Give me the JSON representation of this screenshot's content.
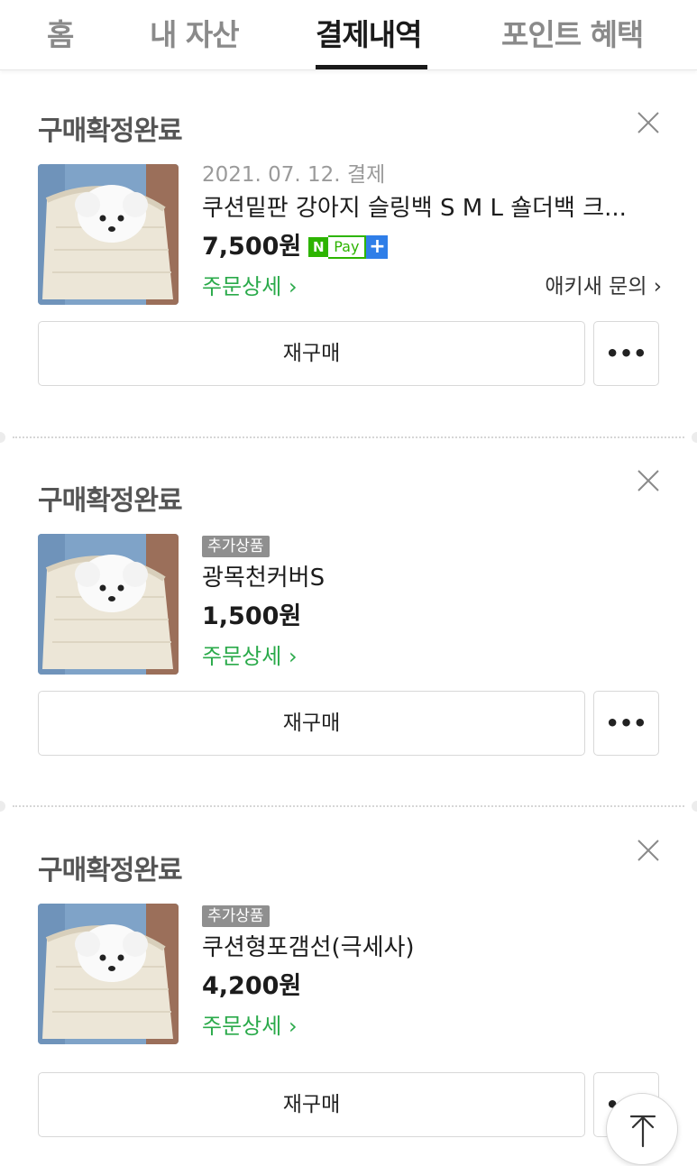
{
  "tabs": [
    {
      "label": "홈"
    },
    {
      "label": "내 자산"
    },
    {
      "label": "결제내역",
      "active": true
    },
    {
      "label": "포인트 혜택"
    }
  ],
  "orders": [
    {
      "status": "구매확정완료",
      "date": "2021. 07. 12. 결제",
      "product_name": "쿠션밑판 강아지 슬링백 S M L 숄더백 크...",
      "price": "7,500원",
      "npay": {
        "n": "N",
        "pay": "Pay",
        "plus": "+"
      },
      "detail_link": "주문상세 ›",
      "inquiry_link": "애키새 문의 ›",
      "rebuy_label": "재구매",
      "more_label": "•••"
    },
    {
      "status": "구매확정완료",
      "badge": "추가상품",
      "product_name": "광목천커버S",
      "price": "1,500원",
      "detail_link": "주문상세 ›",
      "rebuy_label": "재구매",
      "more_label": "•••"
    },
    {
      "status": "구매확정완료",
      "badge": "추가상품",
      "product_name": "쿠션형포갬선(극세사)",
      "price": "4,200원",
      "detail_link": "주문상세 ›",
      "rebuy_label": "재구매",
      "more_label": "•••"
    }
  ],
  "colors": {
    "accent_green": "#2aaa4a",
    "npay_green": "#2db400",
    "npay_blue": "#2f7ee8",
    "badge_gray": "#8f8f8f"
  },
  "icons": {
    "close": "close-icon",
    "scroll_top": "arrow-up-icon",
    "product_image": "puppy-in-sling-bag-photo"
  }
}
